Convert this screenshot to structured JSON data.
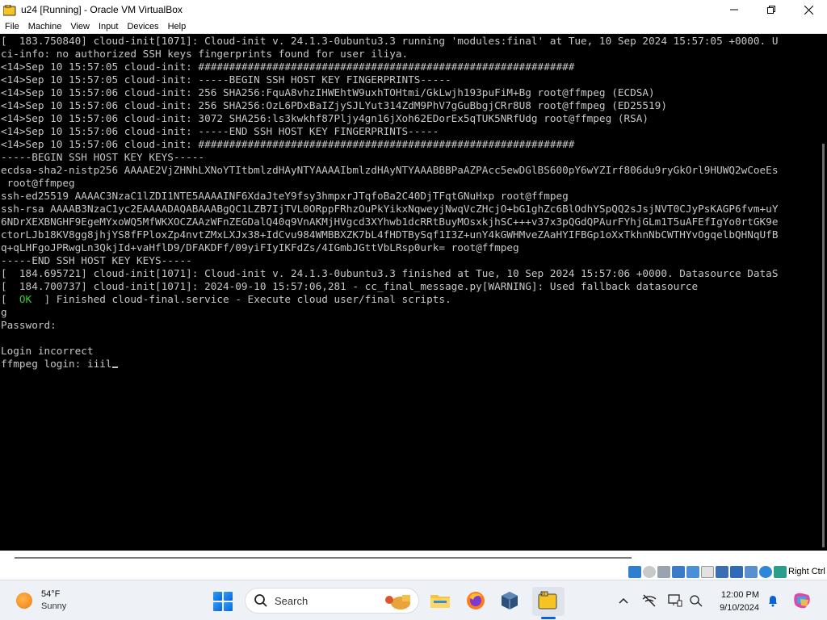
{
  "window": {
    "title": "u24 [Running] - Oracle VM VirtualBox",
    "minimize_icon": "minimize-icon",
    "maximize_icon": "restore-icon",
    "close_icon": "close-icon"
  },
  "menu": [
    "File",
    "Machine",
    "View",
    "Input",
    "Devices",
    "Help"
  ],
  "console": {
    "lines": [
      "[  183.750840] cloud-init[1071]: Cloud-init v. 24.1.3-0ubuntu3.3 running 'modules:final' at Tue, 10 Sep 2024 15:57:05 +0000. U",
      "ci-info: no authorized SSH keys fingerprints found for user iliya.",
      "<14>Sep 10 15:57:05 cloud-init: #############################################################",
      "<14>Sep 10 15:57:05 cloud-init: -----BEGIN SSH HOST KEY FINGERPRINTS-----",
      "<14>Sep 10 15:57:06 cloud-init: 256 SHA256:FquA8vhzIHWEhtW9uxhTOHtmi/GkLwjh193puFiM+Bg root@ffmpeg (ECDSA)",
      "<14>Sep 10 15:57:06 cloud-init: 256 SHA256:OzL6PDxBaIZjySJLYut314ZdM9PhV7gGuBbgjCRr8U8 root@ffmpeg (ED25519)",
      "<14>Sep 10 15:57:06 cloud-init: 3072 SHA256:ls3kwkhf87Pljy4gn16jXoh62EDorEx5qTUK5NRfUdg root@ffmpeg (RSA)",
      "<14>Sep 10 15:57:06 cloud-init: -----END SSH HOST KEY FINGERPRINTS-----",
      "<14>Sep 10 15:57:06 cloud-init: #############################################################",
      "-----BEGIN SSH HOST KEY KEYS-----",
      "ecdsa-sha2-nistp256 AAAAE2VjZHNhLXNoYTItbmlzdHAyNTYAAAAIbmlzdHAyNTYAAABBBPaAZPAcc5ewDGlBS600pY6wYZIrf806du9ryGkOrl9HUWQ2wCoeEs",
      " root@ffmpeg",
      "ssh-ed25519 AAAAC3NzaC1lZDI1NTE5AAAAINF6XdaJteY9fsy3hmpxrJTqfoBa2C40DjTFqtGNuHxp root@ffmpeg",
      "ssh-rsa AAAAB3NzaC1yc2EAAAADAQABAAABgQC1LZB7IjTVL0ORppFRhzOuPkYikxNqweyjNwqVcZHcjO+bG1ghZc6BlOdhYSpQQ2sJsjNVT0CJyPsKAGP6fvm+uY",
      "6NDrXEXBNGHF9EgeMYxoWQ5MfWKXOCZAAzWFnZEGDalQ40q9VnAKMjHVgcd3XYhwb1dcRRtBuyMOsxkjhSC+++v37x3pQGdQPAurFYhjGLm1T5uAFEfIgYo0rtGK9e",
      "ctorLJb18KV8gg8jhjYS8fFPloxZp4nvtZMxLXJx38+IdCvu984WMBBXZK7bL4fHDTBySqf1I3Z+unY4kGWHMveZAaHYIFBGp1oXxTkhnNbCWTHYvOgqelbQHNqUfB",
      "q+qLHFgoJPRwgLn3QkjId+vaHflD9/DFAKDFf/09yiFIyIKFdZs/4IGmbJGttVbLRsp0urk= root@ffmpeg",
      "-----END SSH HOST KEY KEYS-----",
      "[  184.695721] cloud-init[1071]: Cloud-init v. 24.1.3-0ubuntu3.3 finished at Tue, 10 Sep 2024 15:57:06 +0000. Datasource DataS",
      "[  184.700737] cloud-init[1071]: 2024-09-10 15:57:06,281 - cc_final_message.py[WARNING]: Used fallback datasource"
    ],
    "ok_prefix": "[  ",
    "ok_text": "OK",
    "ok_suffix": "  ] Finished cloud-final.service - Execute cloud user/final scripts.",
    "line_g": "g",
    "password_prompt": "Password:",
    "blank": "",
    "login_incorrect": "Login incorrect",
    "login_prompt": "ffmpeg login: iiil"
  },
  "vm_status": {
    "icons": [
      "hard-disk-icon",
      "optical-disk-icon",
      "audio-icon",
      "network-icon",
      "usb-icon",
      "shared-folder-icon",
      "display-icon",
      "video-capture-icon",
      "cpu-icon",
      "mouse-integration-icon",
      "keyboard-icon"
    ],
    "host_key": "Right Ctrl"
  },
  "taskbar": {
    "weather_temp": "54°F",
    "weather_cond": "Sunny",
    "search_placeholder": "Search",
    "apps": [
      "file-explorer-icon",
      "firefox-icon",
      "virtualbox-icon",
      "virtualbox-vm-icon"
    ],
    "tray": [
      "chevron-up-icon",
      "network-off-icon",
      "display-icon",
      "language-icon"
    ],
    "time": "12:00 PM",
    "date": "9/10/2024"
  }
}
